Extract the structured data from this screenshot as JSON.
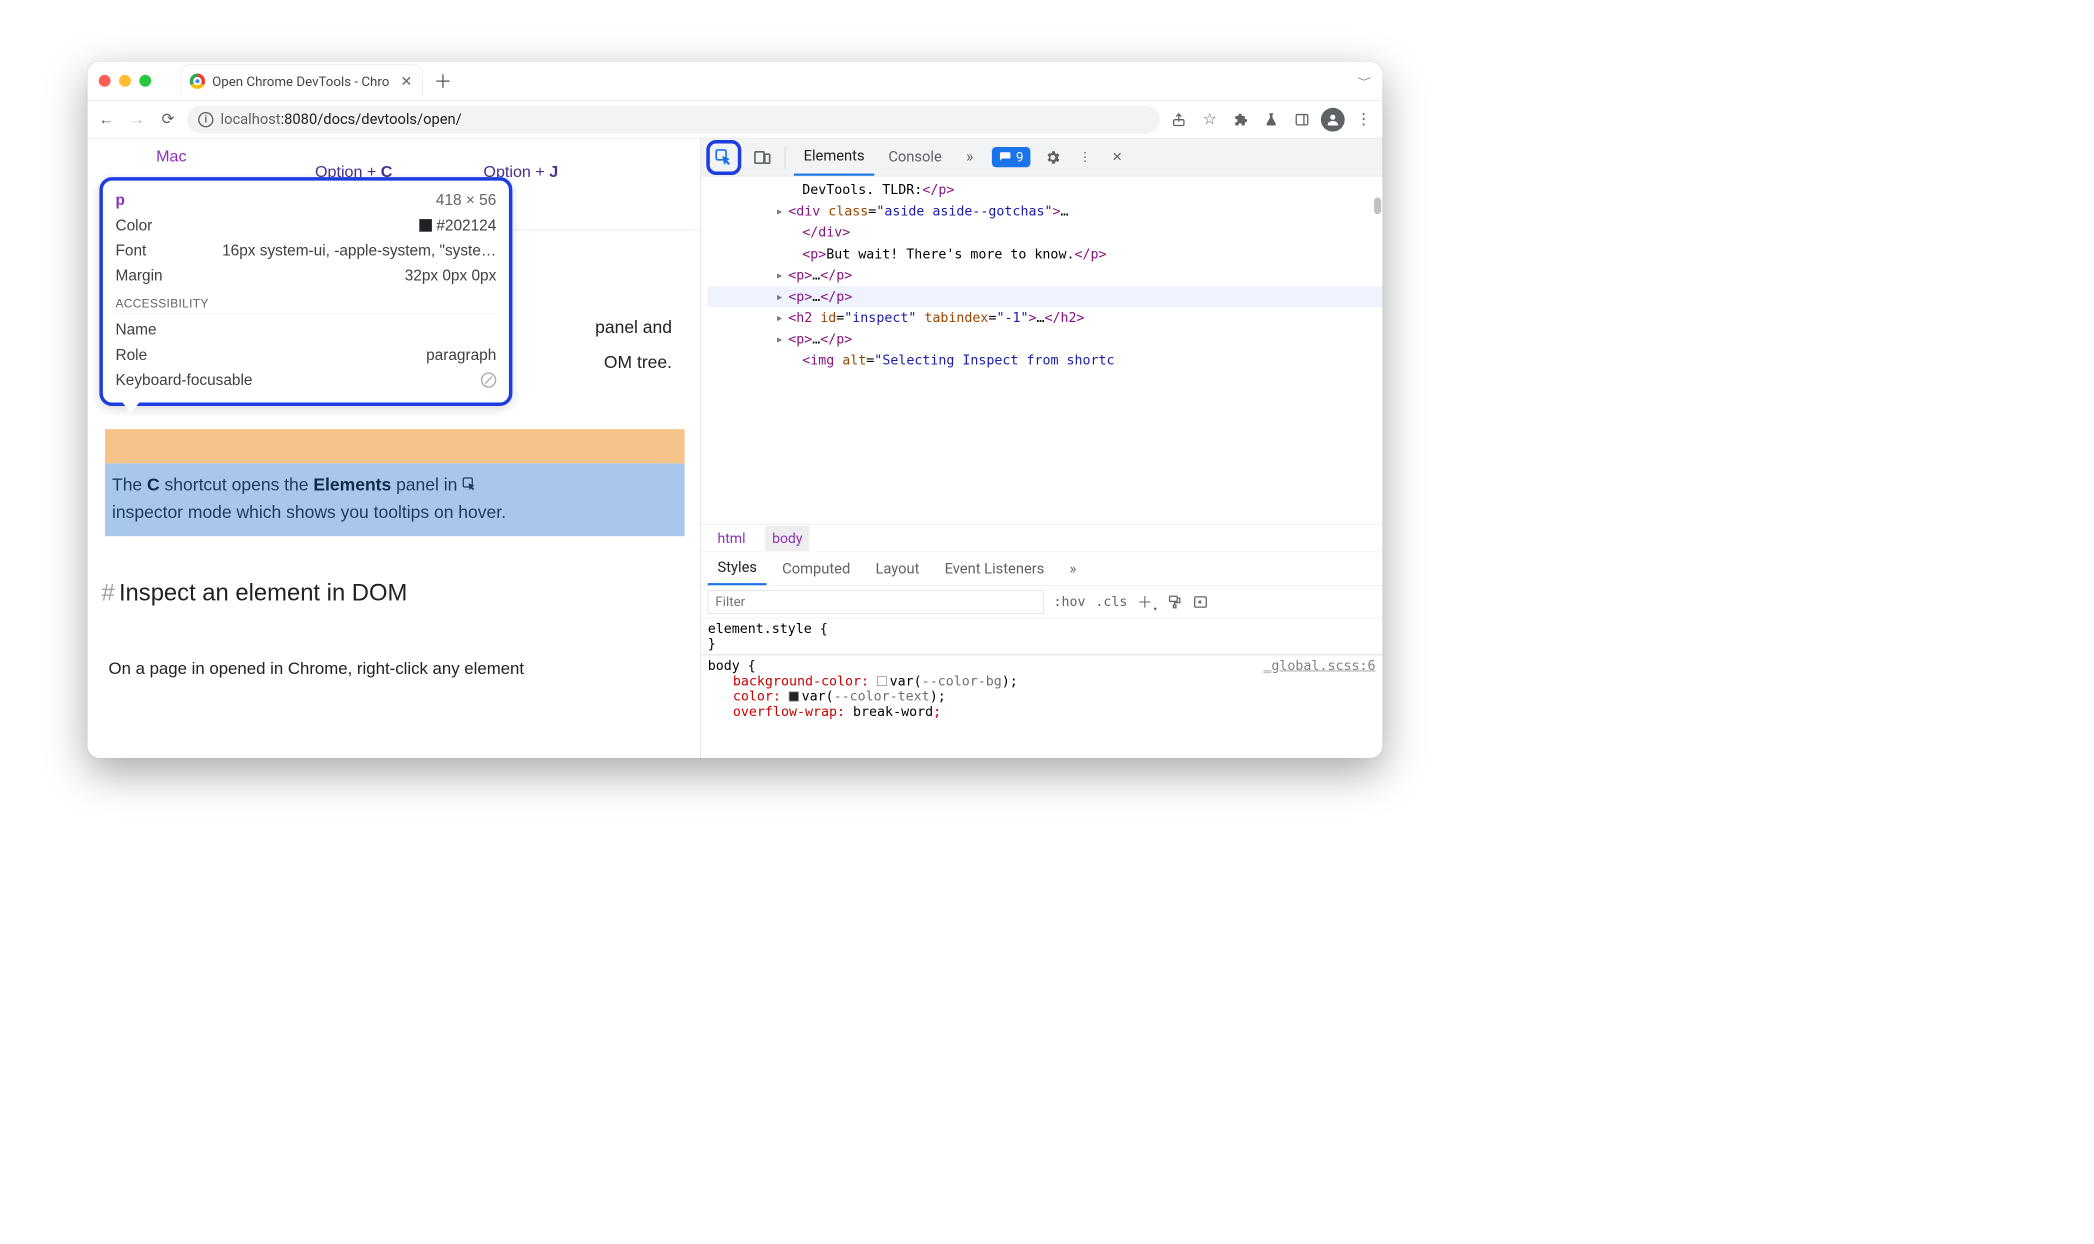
{
  "browser": {
    "tab_title": "Open Chrome DevTools - Chro",
    "url_host": "localhost",
    "url_path": ":8080/docs/devtools/open/"
  },
  "page": {
    "mac_label": "Mac",
    "kbd1_pre": "Option + ",
    "kbd1_key": "C",
    "kbd2_pre": "Option + ",
    "kbd2_key": "J",
    "para_tail_1": " panel and",
    "para_tail_2": "OM tree.",
    "highlight_1a": "The ",
    "highlight_1b": "C",
    "highlight_1c": " shortcut opens the ",
    "highlight_1d": "Elements",
    "highlight_1e": " panel in ",
    "highlight_2": "inspector mode which shows you tooltips on hover.",
    "h2_text": "Inspect an element in DOM",
    "body_text": "On a page in opened in Chrome, right-click any element"
  },
  "tooltip": {
    "selector": "p",
    "dim": "418 × 56",
    "color_label": "Color",
    "color_value": "#202124",
    "font_label": "Font",
    "font_value": "16px system-ui, -apple-system, \"syste…",
    "margin_label": "Margin",
    "margin_value": "32px 0px 0px",
    "acc_heading": "Accessibility",
    "name_label": "Name",
    "role_label": "Role",
    "role_value": "paragraph",
    "keyboard_label": "Keyboard-focusable"
  },
  "devtools": {
    "tab_elements": "Elements",
    "tab_console": "Console",
    "chip_count": "9",
    "dom": {
      "l0": "DevTools. TLDR:</p>",
      "l1a": "<div class=\"aside aside--gotchas\">",
      "l1b": "…",
      "l1c": "</div>",
      "l2a": "<p>",
      "l2txt": "But wait! There's more to know.",
      "l2b": "</p>",
      "l3": "<p>…</p>",
      "l4": "<p>…</p>",
      "l5": "<h2 id=\"inspect\" tabindex=\"-1\">…</h2>",
      "l6": "<p>…</p>",
      "l7a": "<img alt=\"",
      "l7b": "Selecting Inspect from shortc"
    },
    "crumbs": {
      "html": "html",
      "body": "body"
    },
    "styles_tabs": {
      "styles": "Styles",
      "computed": "Computed",
      "layout": "Layout",
      "events": "Event Listeners"
    },
    "filter_placeholder": "Filter",
    "hov": ":hov",
    "cls": ".cls",
    "styles": {
      "elstyle": "element.style {",
      "body_open": "body {",
      "source": "_global.scss:6",
      "p1": "background-color",
      "v1var": "--color-bg",
      "p2": "color",
      "v2var": "--color-text",
      "p3": "overflow-wrap",
      "v3": "break-word"
    }
  }
}
